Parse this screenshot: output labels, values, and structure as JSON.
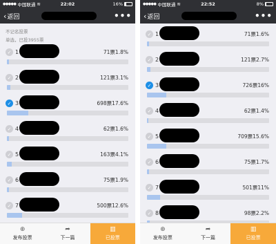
{
  "screens": [
    {
      "status": {
        "carrier": "中国联通",
        "time": "22:02",
        "battery": "16%",
        "battery_level": 0.16
      },
      "nav": {
        "back_label": "返回",
        "menu": "•••"
      },
      "vote_type": "不记名投票",
      "vote_meta": "单选，已投3955票",
      "options": [
        {
          "number": "1",
          "stat": "71票1.8%",
          "percent": 1.8,
          "selected": false
        },
        {
          "number": "2",
          "stat": "121票3.1%",
          "percent": 3.1,
          "selected": false
        },
        {
          "number": "3",
          "stat": "698票17.6%",
          "percent": 17.6,
          "selected": true
        },
        {
          "number": "4",
          "stat": "62票1.6%",
          "percent": 1.6,
          "selected": false
        },
        {
          "number": "5",
          "stat": "163票4.1%",
          "percent": 4.1,
          "selected": false
        },
        {
          "number": "6",
          "stat": "75票1.9%",
          "percent": 1.9,
          "selected": false
        },
        {
          "number": "7",
          "stat": "500票12.6%",
          "percent": 12.6,
          "selected": false
        }
      ],
      "tabbar": [
        {
          "label": "发布投票",
          "icon": "plus-circle-icon"
        },
        {
          "label": "下一篇",
          "icon": "share-arrow-icon"
        },
        {
          "label": "已投票",
          "icon": "bar-chart-icon"
        }
      ]
    },
    {
      "status": {
        "carrier": "中国联通",
        "time": "22:52",
        "battery": "8%",
        "battery_level": 0.08
      },
      "nav": {
        "back_label": "返回",
        "menu": "•••"
      },
      "options": [
        {
          "number": "1",
          "stat": "71票1.6%",
          "percent": 1.6,
          "selected": false
        },
        {
          "number": "2",
          "stat": "121票2.7%",
          "percent": 2.7,
          "selected": false
        },
        {
          "number": "3",
          "stat": "726票16%",
          "percent": 16,
          "selected": true
        },
        {
          "number": "4",
          "stat": "62票1.4%",
          "percent": 1.4,
          "selected": false
        },
        {
          "number": "5",
          "stat": "709票15.6%",
          "percent": 15.6,
          "selected": false
        },
        {
          "number": "6",
          "stat": "75票1.7%",
          "percent": 1.7,
          "selected": false
        },
        {
          "number": "7",
          "stat": "501票11%",
          "percent": 11,
          "selected": false
        },
        {
          "number": "8",
          "stat": "98票2.2%",
          "percent": 2.2,
          "selected": false
        }
      ],
      "tabbar": [
        {
          "label": "发布投票",
          "icon": "plus-circle-icon"
        },
        {
          "label": "下一篇",
          "icon": "share-arrow-icon"
        },
        {
          "label": "已投票",
          "icon": "bar-chart-icon"
        }
      ]
    }
  ],
  "colors": {
    "nav_bg": "#2f3034",
    "check_on": "#1e8fe6",
    "bar_fill": "#a9c5ee",
    "active_tab": "#f7a93a"
  }
}
